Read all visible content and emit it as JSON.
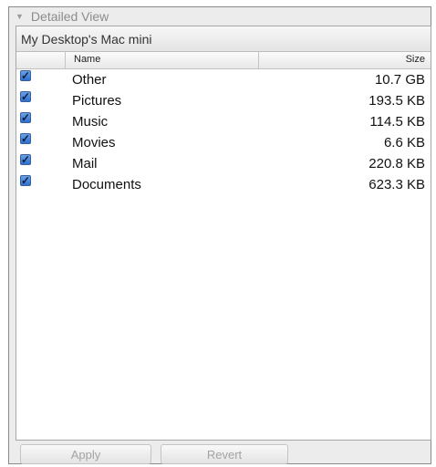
{
  "panel": {
    "disclosure_label": "Detailed View",
    "disclosure_icon": "triangle-down-icon",
    "header_title": "My Desktop's Mac mini"
  },
  "table": {
    "columns": [
      "Name",
      "Size"
    ],
    "rows": [
      {
        "checked": true,
        "name": "Other",
        "size": "10.7 GB"
      },
      {
        "checked": true,
        "name": "Pictures",
        "size": "193.5 KB"
      },
      {
        "checked": true,
        "name": "Music",
        "size": "114.5 KB"
      },
      {
        "checked": true,
        "name": "Movies",
        "size": "6.6 KB"
      },
      {
        "checked": true,
        "name": "Mail",
        "size": "220.8 KB"
      },
      {
        "checked": true,
        "name": "Documents",
        "size": "623.3 KB"
      }
    ]
  },
  "buttons": {
    "apply_label": "Apply",
    "revert_label": "Revert"
  },
  "colors": {
    "checkbox_blue": "#2d6fd0",
    "disabled_text": "#a3a3a3"
  }
}
